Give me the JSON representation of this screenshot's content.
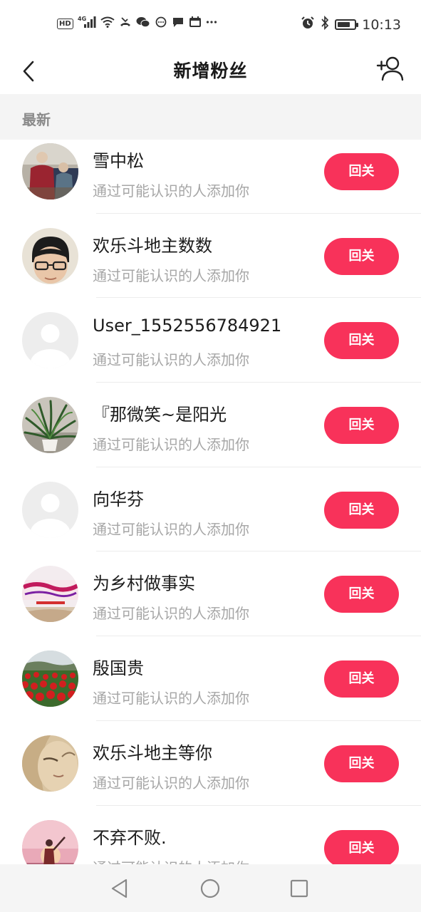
{
  "status_bar": {
    "hd": "HD",
    "network": "4G",
    "time": "10:13",
    "battery_level": 0.75,
    "left_icons": [
      "signal-icon",
      "wifi-icon",
      "missed-call-icon",
      "wechat-icon",
      "chat-bubble-icon",
      "message-icon",
      "calendar-icon",
      "more-dots-icon"
    ],
    "right_icons": [
      "alarm-icon",
      "bluetooth-icon",
      "battery-icon"
    ]
  },
  "nav": {
    "title": "新增粉丝",
    "back_icon": "chevron-left-icon",
    "add_icon": "add-user-icon"
  },
  "section": {
    "label": "最新"
  },
  "colors": {
    "accent": "#f8325a",
    "subtext": "#a6a6a6",
    "section_bg": "#f4f4f4"
  },
  "fans": [
    {
      "name": "雪中松",
      "subtitle": "通过可能认识的人添加你",
      "button": "回关",
      "avatar": "photo-elderly-couple"
    },
    {
      "name": "欢乐斗地主数数",
      "subtitle": "通过可能认识的人添加你",
      "button": "回关",
      "avatar": "photo-person-glasses"
    },
    {
      "name": "User_1552556784921",
      "subtitle": "通过可能认识的人添加你",
      "button": "回关",
      "avatar": "default-avatar"
    },
    {
      "name": "『那微笑~是阳光",
      "subtitle": "通过可能认识的人添加你",
      "button": "回关",
      "avatar": "photo-potted-plant"
    },
    {
      "name": "向华芬",
      "subtitle": "通过可能认识的人添加你",
      "button": "回关",
      "avatar": "default-avatar"
    },
    {
      "name": "为乡村做事实",
      "subtitle": "通过可能认识的人添加你",
      "button": "回关",
      "avatar": "photo-village-banner"
    },
    {
      "name": "殷国贵",
      "subtitle": "通过可能认识的人添加你",
      "button": "回关",
      "avatar": "photo-red-flowers"
    },
    {
      "name": "欢乐斗地主等你",
      "subtitle": "通过可能认识的人添加你",
      "button": "回关",
      "avatar": "photo-face-closeup"
    },
    {
      "name": "不弃不败.",
      "subtitle": "通过可能认识的人添加你",
      "button": "回关",
      "avatar": "photo-sunset-figure"
    }
  ],
  "system_nav": {
    "back": "triangle-back-icon",
    "home": "circle-home-icon",
    "recents": "square-recents-icon"
  }
}
